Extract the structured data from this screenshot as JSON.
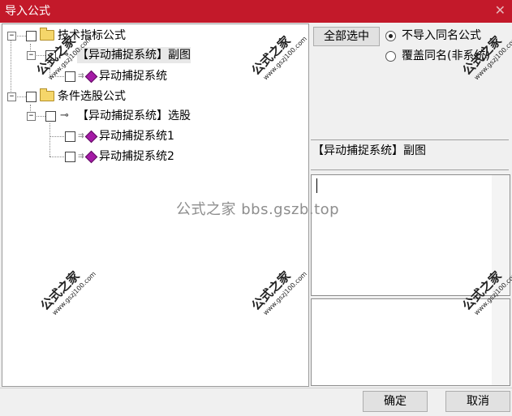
{
  "window": {
    "title": "导入公式",
    "close_glyph": "✕",
    "titlebar_color": "#c3192a"
  },
  "tree": {
    "expander_collapse_glyph": "−",
    "nodes": [
      {
        "id": "tech-group",
        "label": "技术指标公式",
        "icon": "folder-icon",
        "checked": false
      },
      {
        "id": "tech-subgroup",
        "label": "【异动捕捉系统】副图",
        "icon": "key-icon",
        "checked": false,
        "selected": true
      },
      {
        "id": "tech-formula",
        "label": "异动捕捉系统",
        "icon": "formula-gem-icon",
        "checked": false
      },
      {
        "id": "cond-group",
        "label": "条件选股公式",
        "icon": "folder-icon",
        "checked": false
      },
      {
        "id": "cond-subgroup",
        "label": "【异动捕捉系统】选股",
        "icon": "key-icon",
        "checked": false
      },
      {
        "id": "cond-formula-1",
        "label": "异动捕捉系统1",
        "icon": "formula-gem-icon",
        "checked": false
      },
      {
        "id": "cond-formula-2",
        "label": "异动捕捉系统2",
        "icon": "formula-gem-icon",
        "checked": false
      }
    ]
  },
  "options": {
    "select_all_label": "全部选中",
    "radio_skip_label": "不导入同名公式",
    "radio_overwrite_label": "覆盖同名(非系统)",
    "selected_radio": "skip"
  },
  "details": {
    "formula_name": "【异动捕捉系统】副图",
    "formula_text": "",
    "description": ""
  },
  "footer": {
    "ok_label": "确定",
    "cancel_label": "取消"
  },
  "watermark": {
    "center_text": "公式之家 bbs.gszb.top",
    "stamp_title": "公式之家",
    "stamp_url": "www.gszj100.com"
  }
}
